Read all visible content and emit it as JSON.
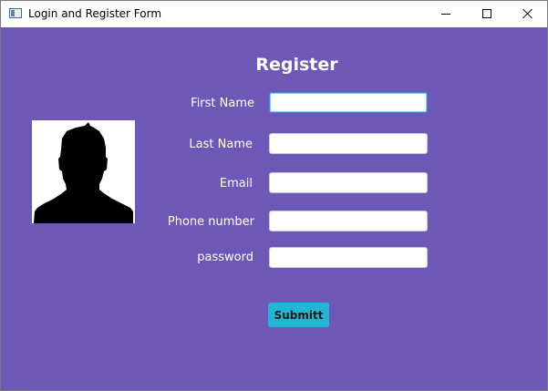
{
  "window": {
    "title": "Login and Register Form",
    "icon": "app-window-icon",
    "controls": [
      "minimize-icon",
      "maximize-icon",
      "close-icon"
    ]
  },
  "colors": {
    "background": "#6e58b7",
    "button": "#23b6d3",
    "text": "#ffffff"
  },
  "form": {
    "heading": "Register",
    "avatar_icon": "person-silhouette-icon",
    "fields": [
      {
        "label": "First Name",
        "value": "",
        "focused": true
      },
      {
        "label": "Last Name",
        "value": ""
      },
      {
        "label": "Email",
        "value": ""
      },
      {
        "label": "Phone number",
        "value": ""
      },
      {
        "label": "password",
        "value": ""
      }
    ],
    "submit_label": "Submitt"
  }
}
